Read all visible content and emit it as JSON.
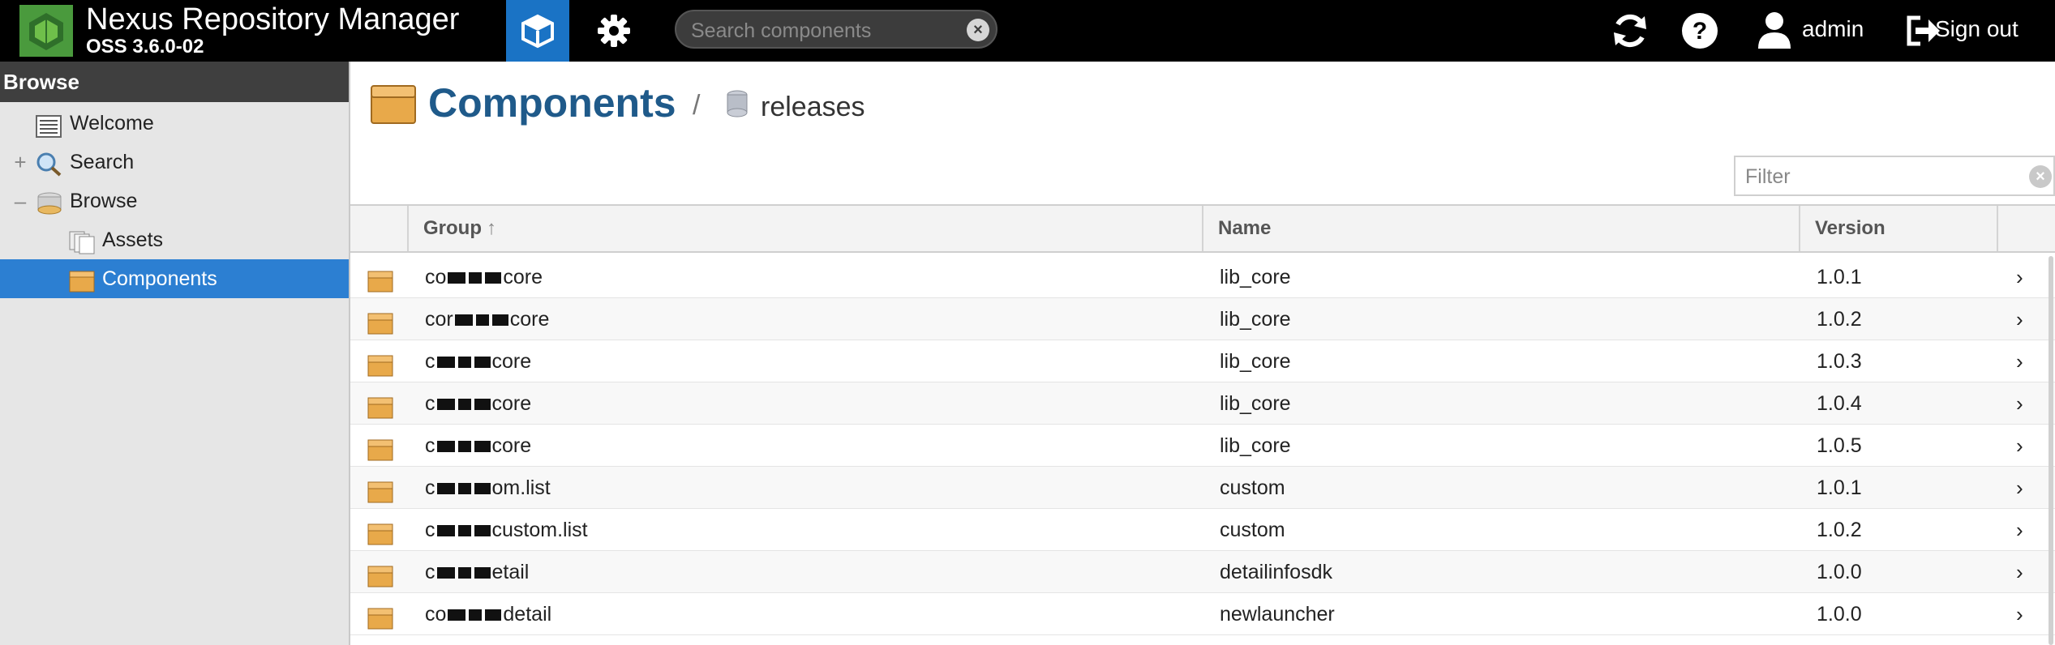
{
  "header": {
    "app_title": "Nexus Repository Manager",
    "app_version": "OSS 3.6.0-02",
    "search_placeholder": "Search components",
    "user": "admin",
    "sign_out": "Sign out"
  },
  "sidebar": {
    "title": "Browse",
    "items": [
      {
        "label": "Welcome",
        "icon": "welcome-icon",
        "expander": ""
      },
      {
        "label": "Search",
        "icon": "search-magnifier-icon",
        "expander": "+"
      },
      {
        "label": "Browse",
        "icon": "database-icon",
        "expander": "–"
      },
      {
        "label": "Assets",
        "icon": "assets-icon",
        "expander": ""
      },
      {
        "label": "Components",
        "icon": "component-box-icon",
        "expander": ""
      }
    ]
  },
  "main": {
    "title": "Components",
    "separator": "/",
    "repository": "releases",
    "filter_placeholder": "Filter",
    "columns": {
      "group": "Group",
      "name": "Name",
      "version": "Version"
    },
    "rows": [
      {
        "group_prefix": "co",
        "group_suffix": "core",
        "name": "lib_core",
        "version": "1.0.1"
      },
      {
        "group_prefix": "cor",
        "group_suffix": "core",
        "name": "lib_core",
        "version": "1.0.2"
      },
      {
        "group_prefix": "c",
        "group_suffix": "core",
        "name": "lib_core",
        "version": "1.0.3"
      },
      {
        "group_prefix": "c",
        "group_suffix": "core",
        "name": "lib_core",
        "version": "1.0.4"
      },
      {
        "group_prefix": "c",
        "group_suffix": "core",
        "name": "lib_core",
        "version": "1.0.5"
      },
      {
        "group_prefix": "c",
        "group_suffix": "om.list",
        "name": "custom",
        "version": "1.0.1"
      },
      {
        "group_prefix": "c",
        "group_suffix": "custom.list",
        "name": "custom",
        "version": "1.0.2"
      },
      {
        "group_prefix": "c",
        "group_suffix": "etail",
        "name": "detailinfosdk",
        "version": "1.0.0"
      },
      {
        "group_prefix": "co",
        "group_suffix": "detail",
        "name": "newlauncher",
        "version": "1.0.0"
      }
    ]
  },
  "colors": {
    "header_bg": "#000000",
    "mode_active": "#1a73c5",
    "selected_nav": "#2c7fd2",
    "title_blue": "#1f5a8a"
  }
}
